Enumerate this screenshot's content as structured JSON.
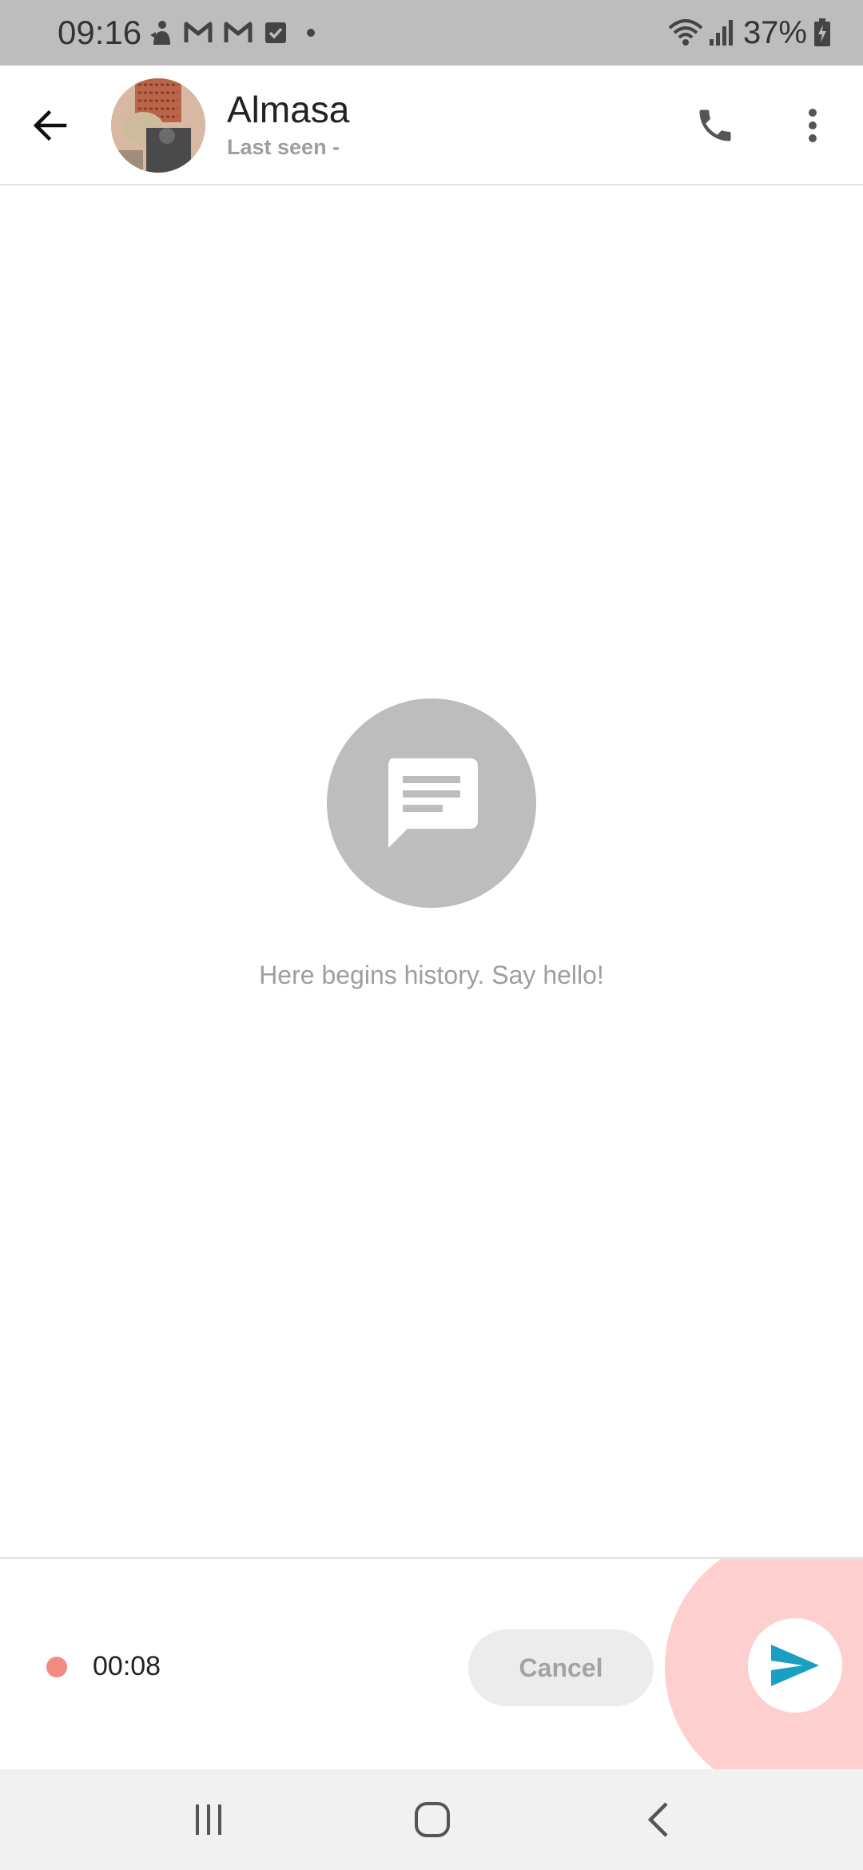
{
  "status_bar": {
    "time": "09:16",
    "battery": "37%",
    "icons": [
      "notification-app-icon",
      "gmail-icon",
      "gmail-icon",
      "checkbox-notification-icon",
      "dot-icon",
      "wifi-icon",
      "signal-icon",
      "battery-charging-icon"
    ]
  },
  "header": {
    "contact_name": "Almasa",
    "last_seen": "Last seen -",
    "icons": {
      "back": "back-arrow-icon",
      "call": "phone-icon",
      "more": "more-vert-icon"
    }
  },
  "chat": {
    "empty_icon": "chat-bubble-icon",
    "empty_text": "Here begins history. Say hello!"
  },
  "recording": {
    "elapsed": "00:08",
    "cancel_label": "Cancel",
    "send_icon": "send-icon"
  },
  "nav_bar": {
    "icons": [
      "recent-apps-icon",
      "home-icon",
      "back-icon"
    ]
  },
  "colors": {
    "status_bar_bg": "#bdbdbd",
    "record_dot": "#f28b82",
    "send_highlight": "#fdd0cf",
    "send_icon": "#1a9fc3",
    "empty_icon_bg": "#bdbdbd"
  }
}
